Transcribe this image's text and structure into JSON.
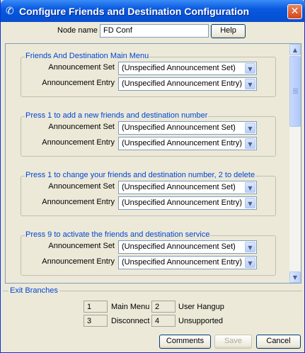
{
  "window": {
    "title": "Configure Friends and Destination Configuration",
    "close_glyph": "✕"
  },
  "node": {
    "label": "Node name",
    "value": "FD Conf",
    "help_label": "Help"
  },
  "groups": [
    {
      "title": "Friends And Destination Main Menu",
      "rows": [
        {
          "label": "Announcement Set",
          "value": "(Unspecified Announcement Set)"
        },
        {
          "label": "Announcement Entry",
          "value": "(Unspecified Announcement Entry)"
        }
      ]
    },
    {
      "title": "Press 1 to add a new friends and destination number",
      "rows": [
        {
          "label": "Announcement Set",
          "value": "(Unspecified Announcement Set)"
        },
        {
          "label": "Announcement Entry",
          "value": "(Unspecified Announcement Entry)"
        }
      ]
    },
    {
      "title": "Press 1 to change your friends and destination number, 2 to delete",
      "rows": [
        {
          "label": "Announcement Set",
          "value": "(Unspecified Announcement Set)"
        },
        {
          "label": "Announcement Entry",
          "value": "(Unspecified Announcement Entry)"
        }
      ]
    },
    {
      "title": "Press 9 to activate the friends and destination service",
      "rows": [
        {
          "label": "Announcement Set",
          "value": "(Unspecified Announcement Set)"
        },
        {
          "label": "Announcement Entry",
          "value": "(Unspecified Announcement Entry)"
        }
      ]
    }
  ],
  "exit": {
    "title": "Exit Branches",
    "branches": [
      {
        "num": "1",
        "name": "Main Menu"
      },
      {
        "num": "2",
        "name": "User Hangup"
      },
      {
        "num": "3",
        "name": "Disconnect"
      },
      {
        "num": "4",
        "name": "Unsupported"
      }
    ]
  },
  "footer": {
    "comments_label": "Comments",
    "save_label": "Save",
    "cancel_label": "Cancel"
  },
  "icons": {
    "title_icon": "phone-icon",
    "dropdown": "chevron-down-icon"
  },
  "colors": {
    "titlebar": "#0553d6",
    "group_title": "#0046d5",
    "window_bg": "#ece9d8"
  }
}
